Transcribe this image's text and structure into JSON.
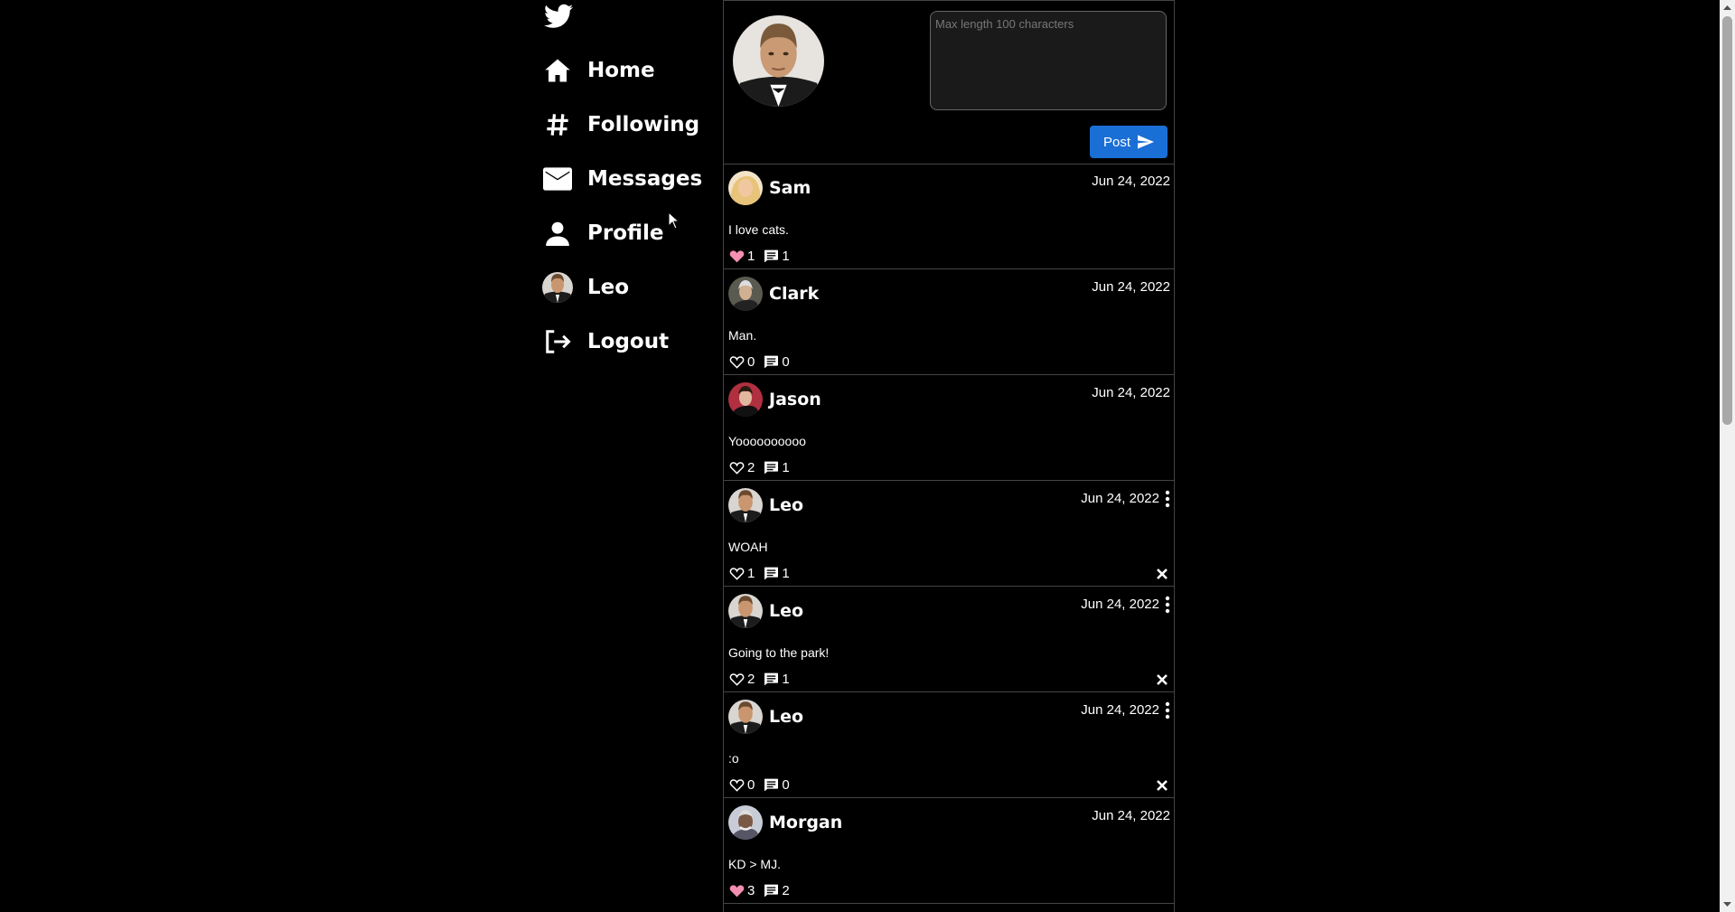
{
  "app": {
    "logo_icon": "twitter-bird-icon",
    "brand_color": "#1a6fd6"
  },
  "sidebar": {
    "items": [
      {
        "label": "Home",
        "icon": "home-icon"
      },
      {
        "label": "Following",
        "icon": "hashtag-icon"
      },
      {
        "label": "Messages",
        "icon": "mail-icon"
      },
      {
        "label": "Profile",
        "icon": "person-icon"
      },
      {
        "label": "Leo",
        "icon": "avatar"
      },
      {
        "label": "Logout",
        "icon": "logout-icon"
      }
    ]
  },
  "composer": {
    "placeholder": "Max length 100 characters",
    "value": "",
    "post_label": "Post"
  },
  "posts": [
    {
      "user": "Sam",
      "date": "Jun 24, 2022",
      "text": "I love cats.",
      "likes": "1",
      "comments": "1",
      "liked": true,
      "own": false
    },
    {
      "user": "Clark",
      "date": "Jun 24, 2022",
      "text": "Man.",
      "likes": "0",
      "comments": "0",
      "liked": false,
      "own": false
    },
    {
      "user": "Jason",
      "date": "Jun 24, 2022",
      "text": "Yoooooooooo",
      "likes": "2",
      "comments": "1",
      "liked": false,
      "own": false
    },
    {
      "user": "Leo",
      "date": "Jun 24, 2022",
      "text": "WOAH",
      "likes": "1",
      "comments": "1",
      "liked": false,
      "own": true
    },
    {
      "user": "Leo",
      "date": "Jun 24, 2022",
      "text": "Going to the park!",
      "likes": "2",
      "comments": "1",
      "liked": false,
      "own": true
    },
    {
      "user": "Leo",
      "date": "Jun 24, 2022",
      "text": ":o",
      "likes": "0",
      "comments": "0",
      "liked": false,
      "own": true
    },
    {
      "user": "Morgan",
      "date": "Jun 24, 2022",
      "text": "KD > MJ.",
      "likes": "3",
      "comments": "2",
      "liked": true,
      "own": false
    }
  ]
}
